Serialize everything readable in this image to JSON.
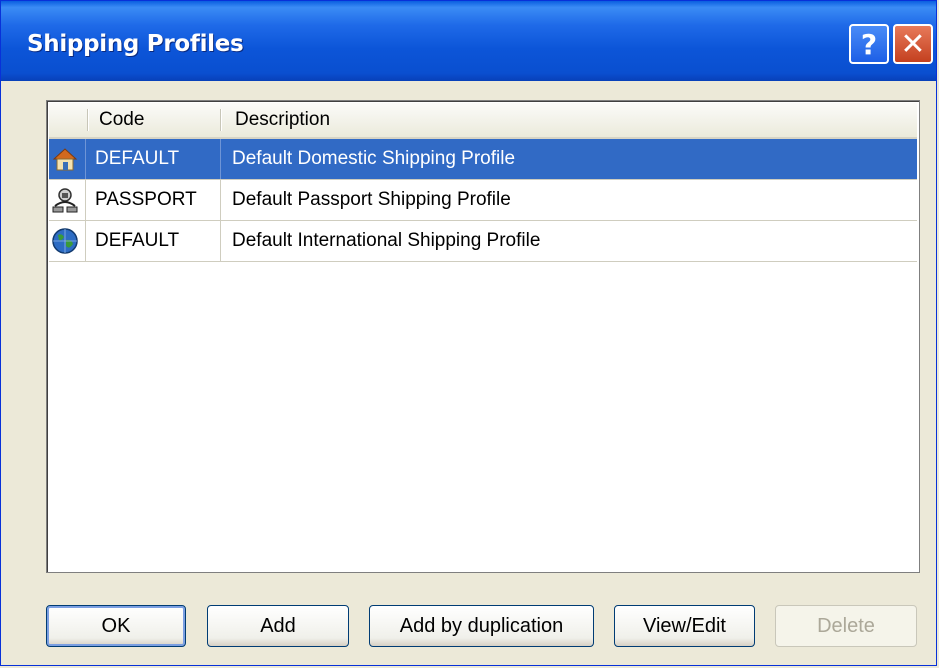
{
  "window": {
    "title": "Shipping Profiles",
    "help_label": "?",
    "close_label": "✕"
  },
  "table": {
    "columns": [
      "Code",
      "Description"
    ],
    "rows": [
      {
        "icon": "house-icon",
        "code": "DEFAULT",
        "description": "Default Domestic Shipping Profile",
        "selected": true
      },
      {
        "icon": "passport-icon",
        "code": "PASSPORT",
        "description": "Default Passport Shipping Profile",
        "selected": false
      },
      {
        "icon": "globe-icon",
        "code": "DEFAULT",
        "description": "Default International Shipping Profile",
        "selected": false
      }
    ]
  },
  "buttons": {
    "ok": "OK",
    "add": "Add",
    "add_dup": "Add by duplication",
    "view_edit": "View/Edit",
    "delete": "Delete"
  },
  "colors": {
    "selection": "#316ac5",
    "titlebar": "#0a55d8",
    "close": "#c4401f"
  }
}
